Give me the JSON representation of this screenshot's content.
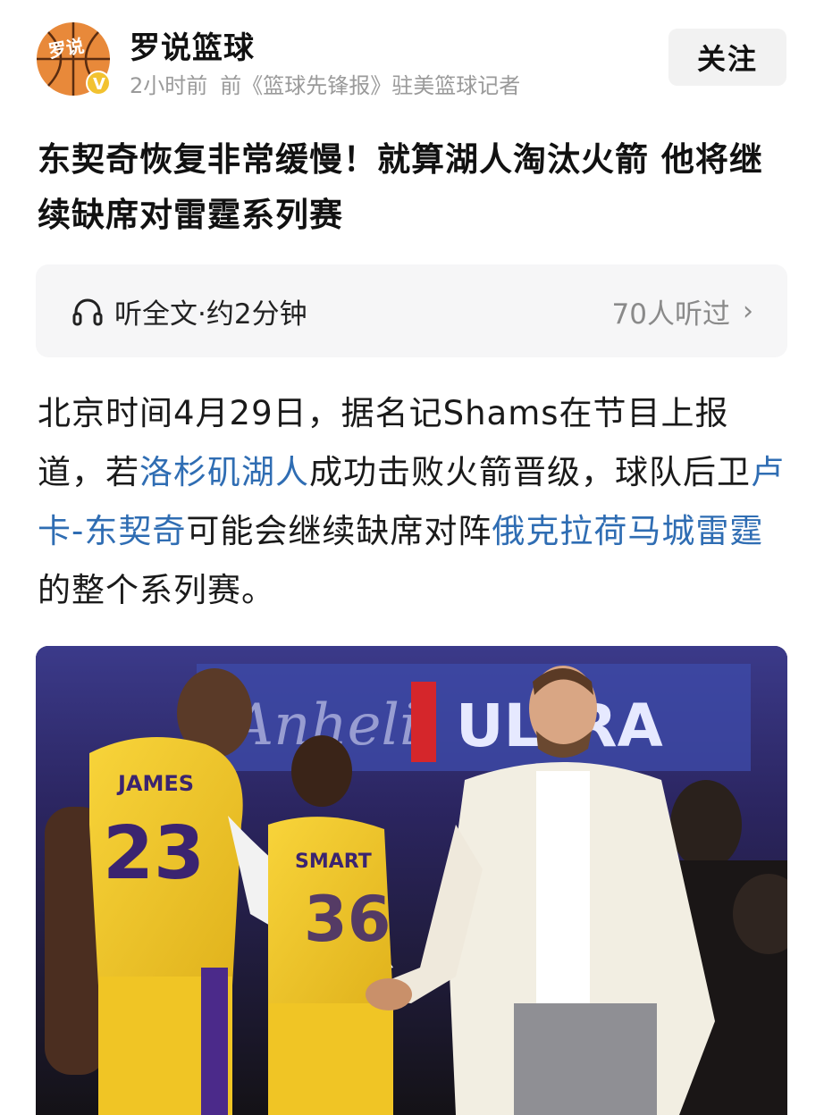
{
  "author": {
    "name": "罗说篮球",
    "avatar_text": "罗说",
    "verified_badge": "V",
    "time": "2小时前",
    "bio": "前《篮球先锋报》驻美篮球记者",
    "follow_label": "关注"
  },
  "article": {
    "title": "东契奇恢复非常缓慢！就算湖人淘汰火箭 他将继续缺席对雷霆系列赛",
    "listen": {
      "icon": "headphones-icon",
      "label": "听全文·约2分钟",
      "listeners": "70人听过",
      "chevron": "›"
    },
    "body": {
      "p1": "北京时间4月29日，据名记Shams在节目上报道，若",
      "link1": "洛杉矶湖人",
      "p2": "成功击败火箭晋级，球队后卫",
      "link2": "卢卡-东契奇",
      "p3": "可能会继续缺席对阵",
      "link3": "俄克拉荷马城雷霆",
      "p4": "的整个系列赛。"
    },
    "photo": {
      "jersey1_name": "JAMES",
      "jersey1_number": "23",
      "jersey2_name": "SMART",
      "jersey2_number": "36",
      "banner_text": "ULTRA"
    }
  },
  "colors": {
    "link": "#2f6db3",
    "lakers_gold": "#f4c829",
    "lakers_purple": "#4b2a8a"
  }
}
